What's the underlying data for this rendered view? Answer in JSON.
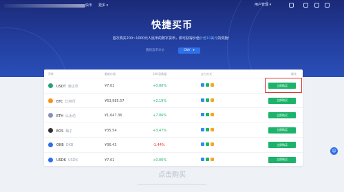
{
  "header": {
    "logo_text": "快币",
    "nav_more": "更多 ▾",
    "user_menu": "用户管理 ▾",
    "settings_icon": "gear-icon",
    "grid_icon": "grid-icon",
    "bell_icon": "bell-icon",
    "window_icon": "window-icon"
  },
  "hero": {
    "title": "快捷买币",
    "subtitle_pre": "首次购买200~1000元人民币的数字货币，即可获得价值",
    "subtitle_link": "价值10美元",
    "subtitle_post": "的奖励！",
    "pay_label": "我的法币计价",
    "currency": "CNY",
    "currency_caret": "▾"
  },
  "table": {
    "headers": [
      "币种",
      "最新价格",
      "24H涨跌幅",
      "支付方式",
      "操作"
    ],
    "rows": [
      {
        "symbol": "USDT",
        "name": "泰达币",
        "price": "¥7.01",
        "change": "+0.00%",
        "change_color": "#1db36b",
        "icon_color": "#26a17b",
        "action": "立即购买"
      },
      {
        "symbol": "BTC",
        "name": "比特币",
        "price": "¥63,985.57",
        "change": "+2.19%",
        "change_color": "#1db36b",
        "icon_color": "#f7931a",
        "action": "立即购买"
      },
      {
        "symbol": "ETH",
        "name": "以太坊",
        "price": "¥1,647.36",
        "change": "+7.06%",
        "change_color": "#1db36b",
        "icon_color": "#8a8fb8",
        "action": "立即购买"
      },
      {
        "symbol": "EOS",
        "name": "柚子",
        "price": "¥35.54",
        "change": "+3.47%",
        "change_color": "#1db36b",
        "icon_color": "#333333",
        "action": "立即购买"
      },
      {
        "symbol": "OKB",
        "name": "OKB",
        "price": "¥36.43",
        "change": "-1.44%",
        "change_color": "#e0322b",
        "icon_color": "#2f6fe8",
        "action": "立即购买"
      },
      {
        "symbol": "USDK",
        "name": "USDK",
        "price": "¥7.01",
        "change": "+0.00%",
        "change_color": "#1db36b",
        "icon_color": "#2f6fe8",
        "action": "立即购买"
      }
    ]
  },
  "payment_icons": [
    "alipay-icon",
    "wechat-icon",
    "bankcard-icon"
  ],
  "footer": {
    "title": "点击购买"
  },
  "float_button": {
    "label": "☺"
  }
}
